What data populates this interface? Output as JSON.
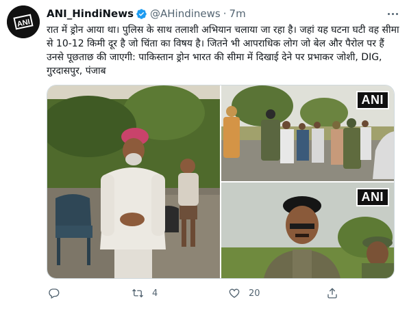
{
  "tweet": {
    "display_name": "ANI_HindiNews",
    "handle": "@AHindinews",
    "separator": "·",
    "time": "7m",
    "text": "रात में ड्रोन आया था। पुलिस के साथ तलाशी अभियान चलाया जा रहा है। जहां यह घटना घटी वह सीमा से 10-12 किमी दूर है जो चिंता का विषय है। जितने भी आपराधिक लोग जो बेल और पैरोल पर हैं उनसे पूछताछ की जाएगी: पाकिस्तान ड्रोन भारत की सीमा में दिखाई देने पर प्रभाकर जोशी, DIG, गुरदासपुर, पंजाब",
    "avatar_logo": "ANI"
  },
  "media": {
    "badge_top_right": "ANI",
    "badge_bottom_right": "ANI"
  },
  "actions": {
    "reply_count": "",
    "retweet_count": "4",
    "like_count": "20"
  },
  "colors": {
    "text": "#0f1419",
    "secondary": "#536471",
    "verified": "#1d9bf0",
    "border": "#cfd9de"
  }
}
